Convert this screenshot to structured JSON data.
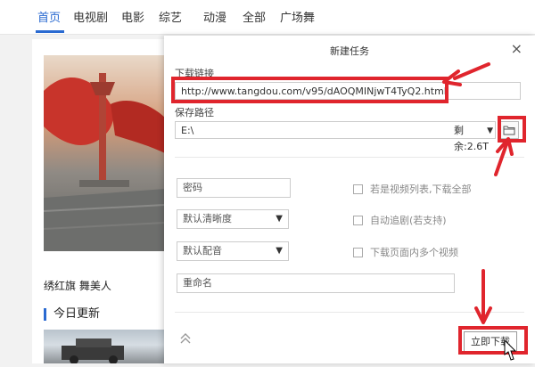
{
  "nav": {
    "items": [
      "首页",
      "电视剧",
      "电影",
      "综艺",
      "动漫",
      "全部",
      "广场舞"
    ],
    "active_index": 0
  },
  "left": {
    "caption": "绣红旗 舞美人",
    "section_title": "今日更新"
  },
  "dialog": {
    "title": "新建任务",
    "close_symbol": "×",
    "url_label": "下载链接",
    "url_value": "http://www.tangdou.com/v95/dAOQMINjwT4TyQ2.html",
    "path_label": "保存路径",
    "path_value": "E:\\",
    "remaining": "剩余:2.6T",
    "password_placeholder": "密码",
    "resolution_value": "默认清晰度",
    "audio_value": "默认配音",
    "rename_placeholder": "重命名",
    "options": [
      "若是视频列表,下载全部",
      "自动追剧(若支持)",
      "下载页面内多个视频"
    ],
    "download_button": "立即下载"
  },
  "colors": {
    "accent": "#2a6ad1",
    "annotation": "#e0252d"
  }
}
